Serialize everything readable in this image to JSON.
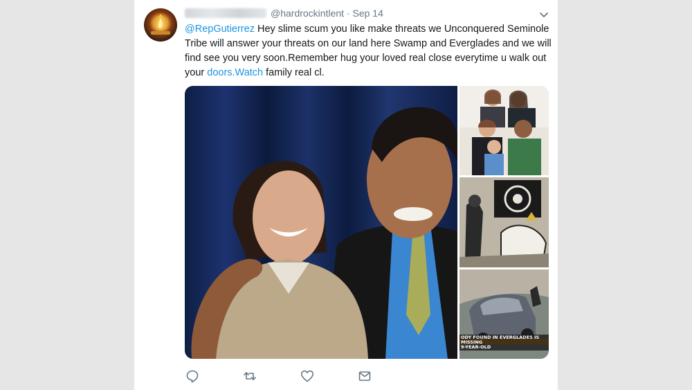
{
  "tweet": {
    "handle": "@hardrockintlent",
    "separator": "·",
    "date": "Sep 14",
    "mention": "@RepGutierrez",
    "text_part1": " Hey slime scum you like make threats we Unconquered Seminole Tribe will answer your threats on our land here Swamp and Everglades and we will find see you very soon.Remember hug your loved real close everytime u walk out your ",
    "link_text": "doors.Watch",
    "text_part2": " family real cl."
  },
  "media": {
    "news_caption_line1": "ODY FOUND IN EVERGLADES IS MISSING",
    "news_caption_line2": "9-YEAR-OLD"
  },
  "icons": {
    "reply": "reply-icon",
    "retweet": "retweet-icon",
    "like": "like-icon",
    "message": "message-icon",
    "caret": "chevron-down-icon"
  },
  "colors": {
    "link": "#1b95e0",
    "text": "#14171a",
    "meta": "#657786"
  }
}
